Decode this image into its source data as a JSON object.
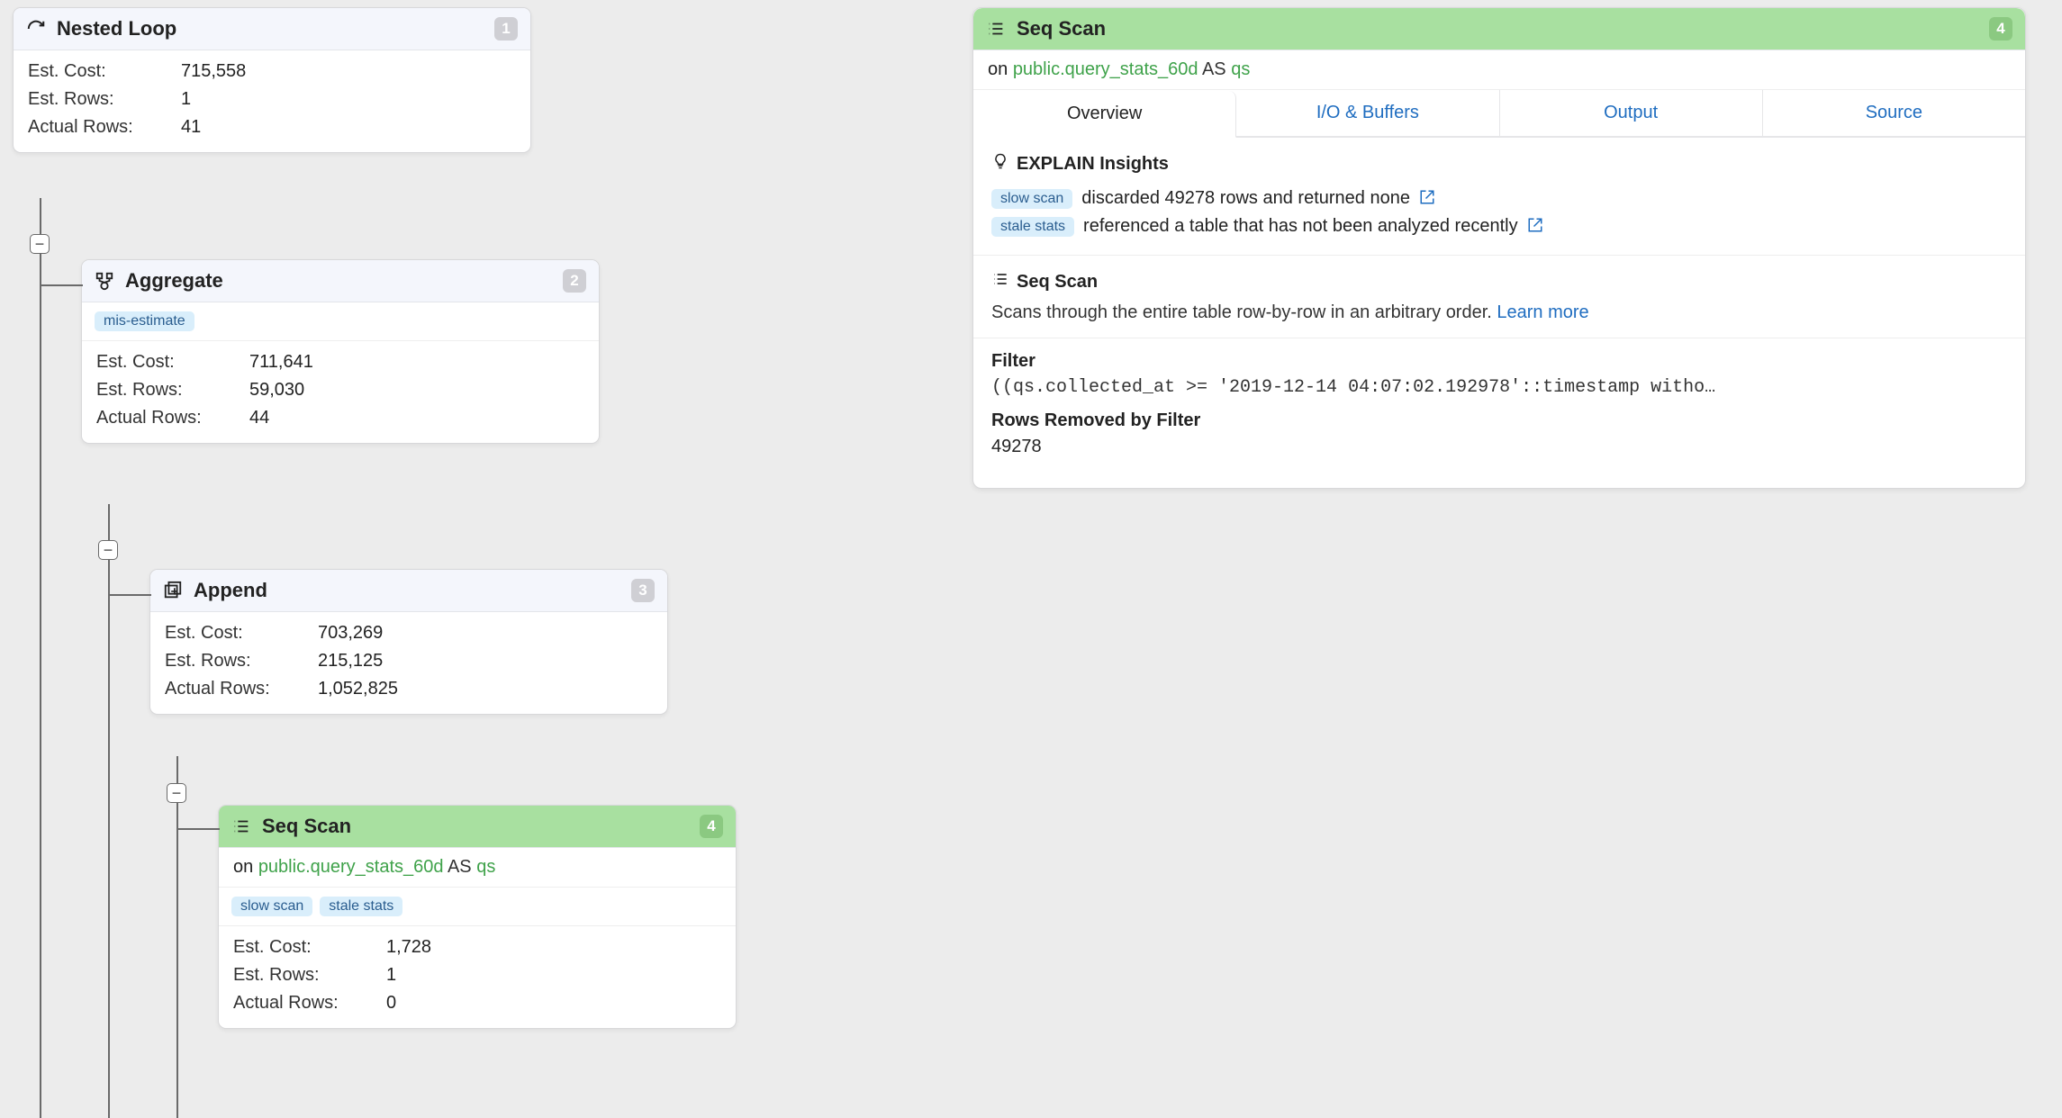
{
  "labels": {
    "est_cost": "Est. Cost:",
    "est_rows": "Est. Rows:",
    "actual_rows": "Actual Rows:",
    "on": "on",
    "as": "AS"
  },
  "nodes": {
    "n1": {
      "title": "Nested Loop",
      "num": "1",
      "est_cost": "715,558",
      "est_rows": "1",
      "actual_rows": "41"
    },
    "n2": {
      "title": "Aggregate",
      "num": "2",
      "tag": "mis-estimate",
      "est_cost": "711,641",
      "est_rows": "59,030",
      "actual_rows": "44"
    },
    "n3": {
      "title": "Append",
      "num": "3",
      "est_cost": "703,269",
      "est_rows": "215,125",
      "actual_rows": "1,052,825"
    },
    "n4": {
      "title": "Seq Scan",
      "num": "4",
      "table": "public.query_stats_60d",
      "alias": "qs",
      "tag1": "slow scan",
      "tag2": "stale stats",
      "est_cost": "1,728",
      "est_rows": "1",
      "actual_rows": "0"
    }
  },
  "detail": {
    "title": "Seq Scan",
    "num": "4",
    "table": "public.query_stats_60d",
    "alias": "qs",
    "tabs": {
      "overview": "Overview",
      "io": "I/O & Buffers",
      "output": "Output",
      "source": "Source"
    },
    "insights_title": "EXPLAIN Insights",
    "insight1_tag": "slow scan",
    "insight1_text": "discarded 49278 rows and returned none",
    "insight2_tag": "stale stats",
    "insight2_text": "referenced a table that has not been analyzed recently",
    "scan_title": "Seq Scan",
    "scan_desc": "Scans through the entire table row-by-row in an arbitrary order. ",
    "learn_more": "Learn more",
    "filter_label": "Filter",
    "filter_value": "((qs.collected_at >= '2019-12-14 04:07:02.192978'::timestamp witho…",
    "rows_removed_label": "Rows Removed by Filter",
    "rows_removed_value": "49278"
  },
  "toggle_glyph": "−"
}
